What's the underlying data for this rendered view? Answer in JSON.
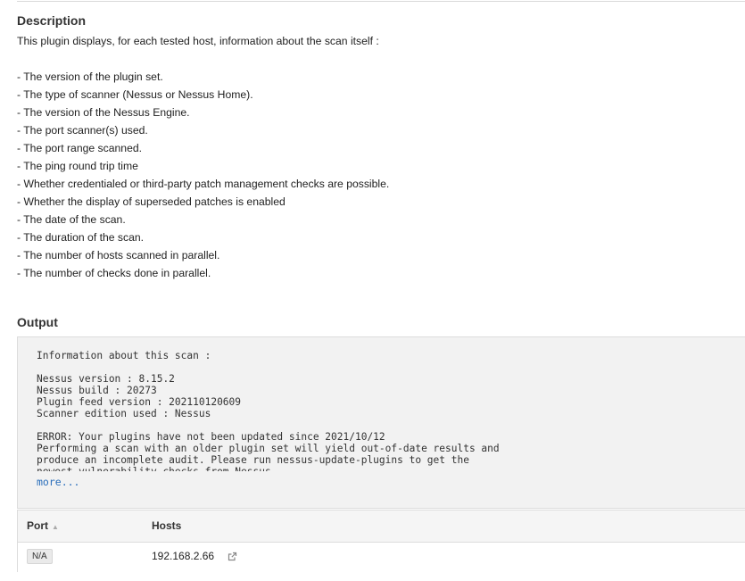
{
  "description": {
    "title": "Description",
    "intro": "This plugin displays, for each tested host, information about the scan itself :",
    "items": [
      "- The version of the plugin set.",
      "- The type of scanner (Nessus or Nessus Home).",
      "- The version of the Nessus Engine.",
      "- The port scanner(s) used.",
      "- The port range scanned.",
      "- The ping round trip time",
      "- Whether credentialed or third-party patch management checks are possible.",
      "- Whether the display of superseded patches is enabled",
      "- The date of the scan.",
      "- The duration of the scan.",
      "- The number of hosts scanned in parallel.",
      "- The number of checks done in parallel."
    ]
  },
  "output": {
    "title": "Output",
    "text": "Information about this scan :\n\nNessus version : 8.15.2\nNessus build : 20273\nPlugin feed version : 202110120609\nScanner edition used : Nessus\n\nERROR: Your plugins have not been updated since 2021/10/12\nPerforming a scan with an older plugin set will yield out-of-date results and\nproduce an incomplete audit. Please run nessus-update-plugins to get the\nnewest vulnerability checks from Nessus.",
    "more_label": "more..."
  },
  "table": {
    "columns": {
      "port": "Port",
      "hosts": "Hosts"
    },
    "rows": [
      {
        "port": "N/A",
        "host": "192.168.2.66"
      }
    ]
  },
  "icons": {
    "sort": "sort-ascending-icon",
    "external": "external-link-icon"
  }
}
